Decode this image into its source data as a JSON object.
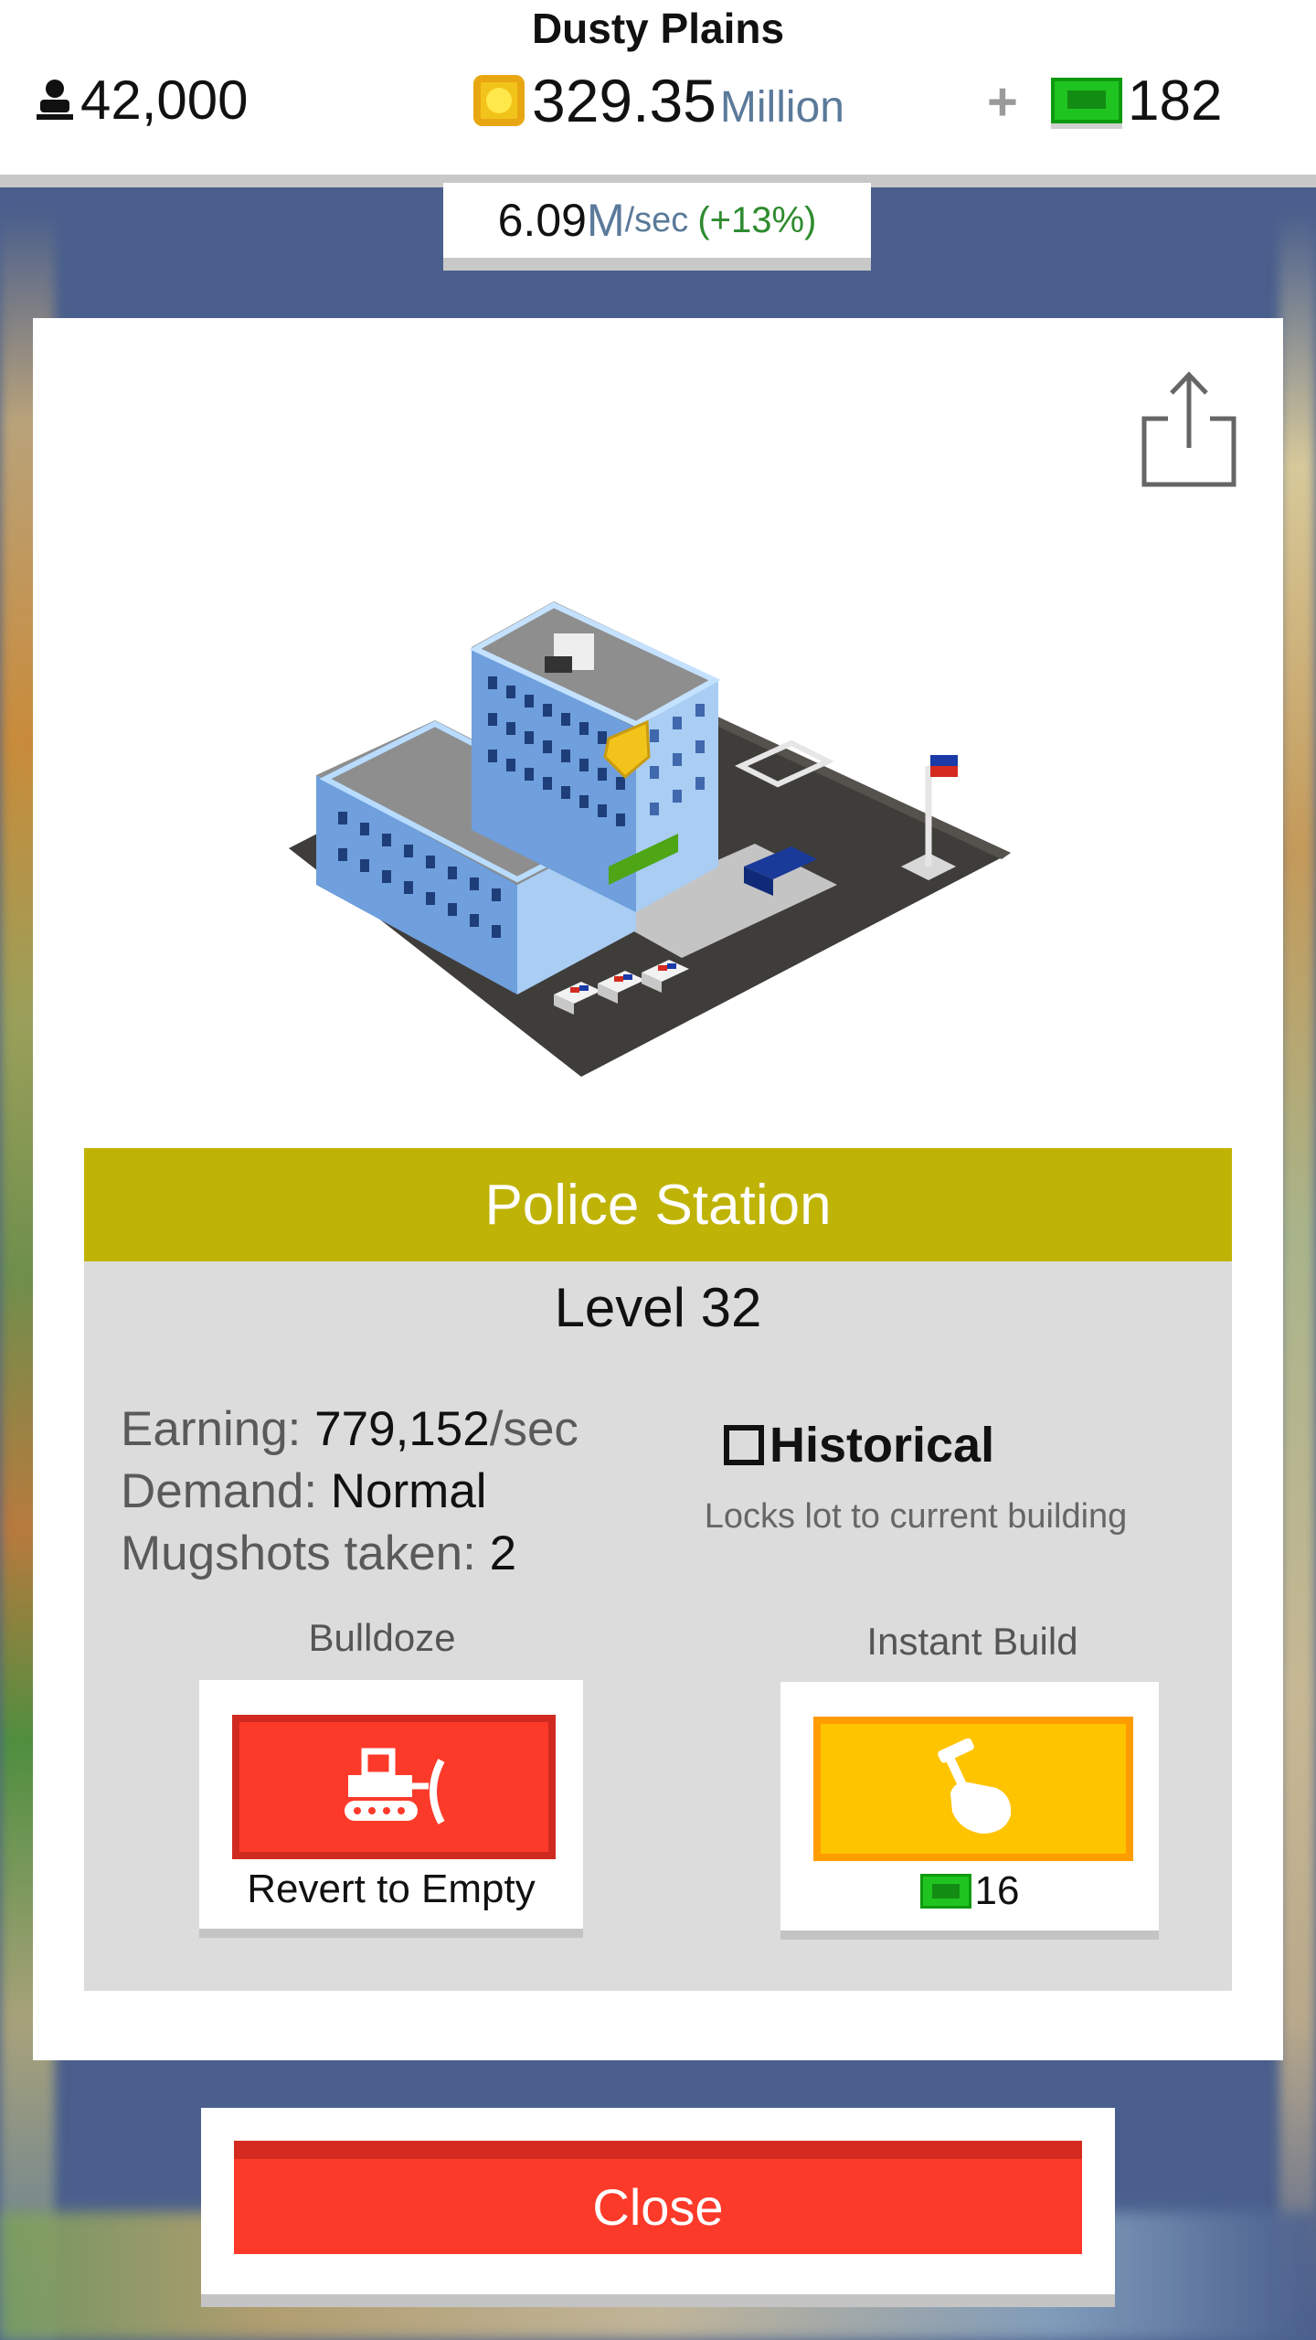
{
  "hud": {
    "city_name": "Dusty Plains",
    "population": "42,000",
    "money_value": "329.35",
    "money_unit": "Million",
    "plus": "+",
    "cash": "182",
    "rate_value": "6.09",
    "rate_unit": "M",
    "rate_per": "/sec",
    "rate_change": "(+13%)"
  },
  "icons": {
    "population": "person-icon",
    "money": "coin-icon",
    "cash": "cash-bill-icon",
    "share": "share-icon",
    "bulldoze": "bulldozer-icon",
    "instant_build": "hammer-hand-icon"
  },
  "building": {
    "name": "Police Station",
    "level": "Level 32",
    "stats": [
      {
        "key": "Earning: ",
        "value": "779,152",
        "suffix": "/sec"
      },
      {
        "key": "Demand: ",
        "value": "Normal"
      },
      {
        "key": "Mugshots taken: ",
        "value": "2"
      }
    ],
    "historical_label": "Historical",
    "historical_checked": false,
    "historical_desc": "Locks lot to current building"
  },
  "actions": {
    "bulldoze_label": "Bulldoze",
    "bulldoze_caption": "Revert to Empty",
    "instant_build_label": "Instant Build",
    "instant_build_cost": "16"
  },
  "close_label": "Close",
  "colors": {
    "title_bar": "#bfb306",
    "bulldoze": "#fc3a2a",
    "instant_build": "#ffc400",
    "close": "#fc3a2a",
    "background": "#4a5f8d"
  }
}
